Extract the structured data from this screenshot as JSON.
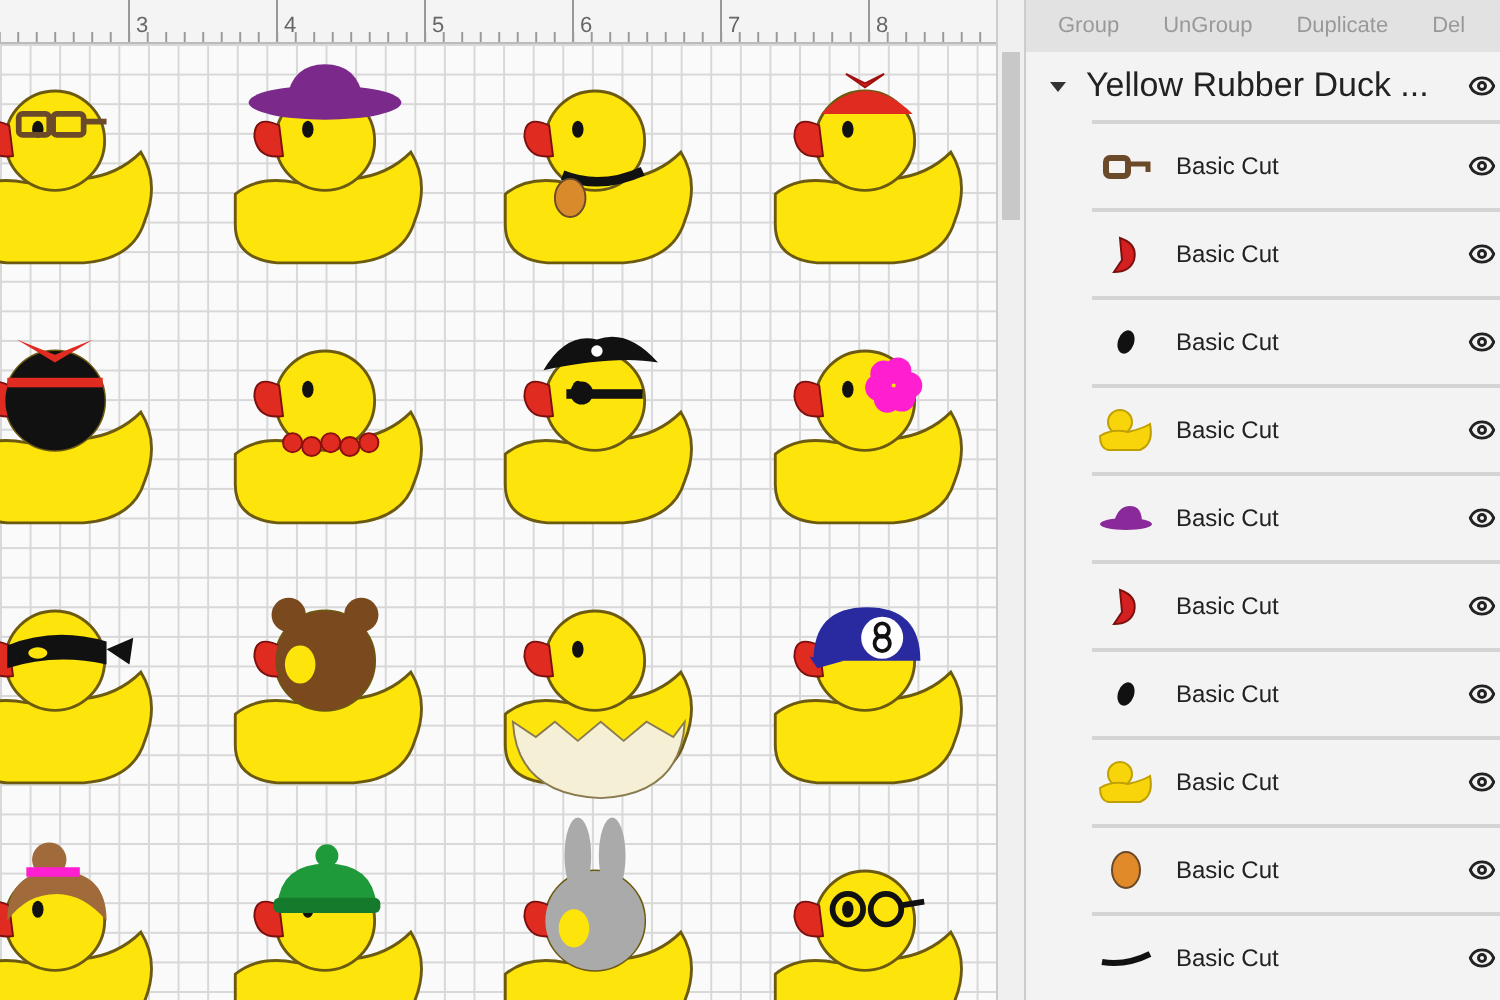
{
  "ruler": {
    "labels": [
      "3",
      "4",
      "5",
      "6",
      "7",
      "8"
    ]
  },
  "canvas": {
    "ducks": [
      {
        "kind": "glasses"
      },
      {
        "kind": "hat"
      },
      {
        "kind": "collar"
      },
      {
        "kind": "propeller"
      },
      {
        "kind": "helicopter_hair"
      },
      {
        "kind": "necklace"
      },
      {
        "kind": "pirate"
      },
      {
        "kind": "flower"
      },
      {
        "kind": "mask"
      },
      {
        "kind": "bear"
      },
      {
        "kind": "eggshell"
      },
      {
        "kind": "helmet"
      },
      {
        "kind": "bun"
      },
      {
        "kind": "beanie"
      },
      {
        "kind": "bunny"
      },
      {
        "kind": "round_glasses"
      }
    ]
  },
  "toolbar": {
    "buttons": [
      "Group",
      "UnGroup",
      "Duplicate",
      "Del"
    ]
  },
  "layers": {
    "group": {
      "name": "Yellow Rubber Duck ...",
      "expanded": true
    },
    "items": [
      {
        "kind": "glasses",
        "name": "Basic Cut"
      },
      {
        "kind": "beak",
        "name": "Basic Cut"
      },
      {
        "kind": "eye",
        "name": "Basic Cut"
      },
      {
        "kind": "body",
        "name": "Basic Cut"
      },
      {
        "kind": "hat",
        "name": "Basic Cut"
      },
      {
        "kind": "beak",
        "name": "Basic Cut"
      },
      {
        "kind": "eye",
        "name": "Basic Cut"
      },
      {
        "kind": "body",
        "name": "Basic Cut"
      },
      {
        "kind": "cheek",
        "name": "Basic Cut"
      },
      {
        "kind": "mouth",
        "name": "Basic Cut"
      }
    ]
  }
}
